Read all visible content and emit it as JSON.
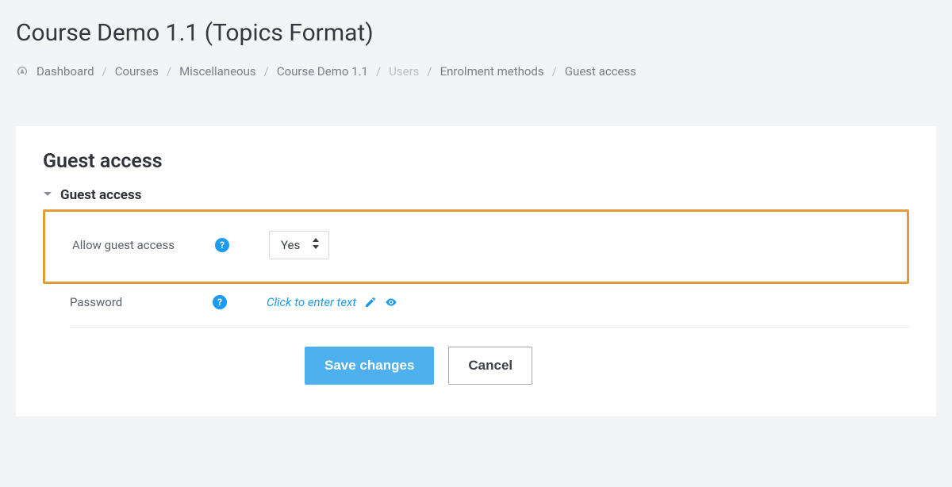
{
  "page": {
    "title": "Course Demo 1.1 (Topics Format)"
  },
  "breadcrumb": {
    "items": [
      {
        "label": "Dashboard",
        "muted": false
      },
      {
        "label": "Courses",
        "muted": false
      },
      {
        "label": "Miscellaneous",
        "muted": false
      },
      {
        "label": "Course Demo 1.1",
        "muted": false
      },
      {
        "label": "Users",
        "muted": true
      },
      {
        "label": "Enrolment methods",
        "muted": false
      },
      {
        "label": "Guest access",
        "muted": false
      }
    ]
  },
  "card": {
    "title": "Guest access",
    "section_title": "Guest access",
    "allow_label": "Allow guest access",
    "allow_value": "Yes",
    "password_label": "Password",
    "password_placeholder": "Click to enter text",
    "save_label": "Save changes",
    "cancel_label": "Cancel"
  },
  "icons": {
    "dashboard": "dashboard-icon",
    "help": "?",
    "caret": "chevron-down-icon",
    "sort": "sort-icon",
    "pen": "pencil-icon",
    "eye": "eye-icon"
  }
}
